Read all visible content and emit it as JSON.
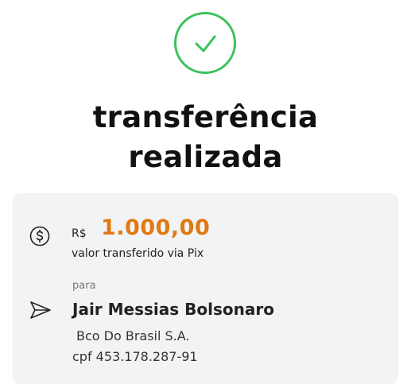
{
  "header": {
    "title_line1": "transferência",
    "title_line2": "realizada",
    "success_icon": "check-circle-icon",
    "accent_color": "#3cc25a"
  },
  "transfer": {
    "currency_symbol": "R$",
    "amount": "1.000,00",
    "amount_color": "#df7a12",
    "caption": "valor transferido via Pix",
    "amount_icon": "dollar-circle-icon"
  },
  "recipient": {
    "label": "para",
    "name": "Jair Messias Bolsonaro",
    "bank": "Bco Do Brasil S.A.",
    "document": "cpf 453.178.287-91",
    "icon": "send-icon"
  }
}
